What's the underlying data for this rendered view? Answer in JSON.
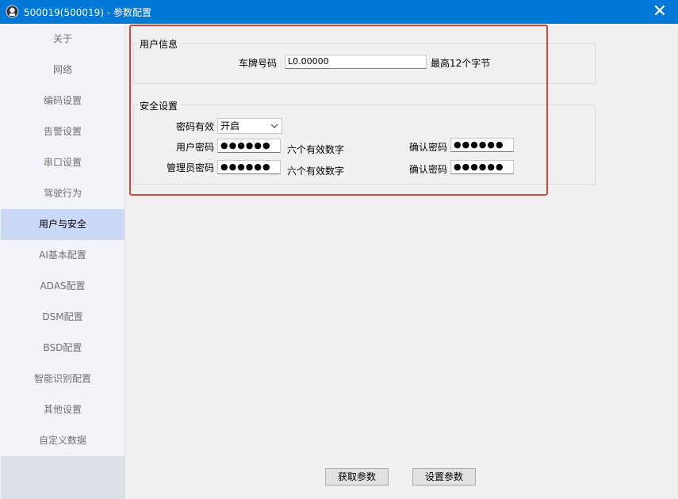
{
  "window": {
    "title": "500019(500019) - 参数配置",
    "close_glyph": "✕"
  },
  "sidebar": {
    "items": [
      {
        "label": "关于"
      },
      {
        "label": "网络"
      },
      {
        "label": "编码设置"
      },
      {
        "label": "告警设置"
      },
      {
        "label": "串口设置"
      },
      {
        "label": "驾驶行为"
      },
      {
        "label": "用户与安全",
        "active": true
      },
      {
        "label": "AI基本配置"
      },
      {
        "label": "ADAS配置"
      },
      {
        "label": "DSM配置"
      },
      {
        "label": "BSD配置"
      },
      {
        "label": "智能识别配置"
      },
      {
        "label": "其他设置"
      },
      {
        "label": "自定义数据"
      }
    ]
  },
  "user_info": {
    "group_title": "用户信息",
    "plate_label": "车牌号码",
    "plate_value": "L0.00000",
    "plate_hint": "最高12个字节"
  },
  "security": {
    "group_title": "安全设置",
    "pwd_enabled_label": "密码有效",
    "pwd_enabled_value": "开启",
    "user_pwd_label": "用户密码",
    "user_pwd_value": "●●●●●●",
    "user_pwd_hint": "六个有效数字",
    "user_confirm_label": "确认密码",
    "user_confirm_value": "●●●●●●",
    "admin_pwd_label": "管理员密码",
    "admin_pwd_value": "●●●●●●",
    "admin_pwd_hint": "六个有效数字",
    "admin_confirm_label": "确认密码",
    "admin_confirm_value": "●●●●●●"
  },
  "footer": {
    "get_params": "获取参数",
    "set_params": "设置参数"
  },
  "colors": {
    "titlebar": "#0078d7",
    "active_nav": "#cad8f6",
    "highlight": "#e04040"
  },
  "icons": {
    "app": "app-icon",
    "close": "close-icon",
    "dropdown": "chevron-down-icon"
  }
}
